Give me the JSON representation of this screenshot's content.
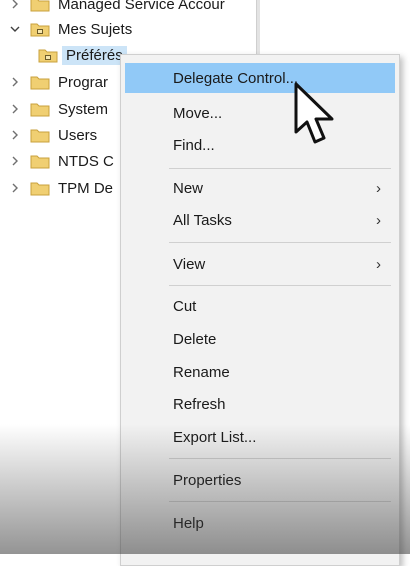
{
  "tree": {
    "items": [
      {
        "label": "Managed Service Accour",
        "expander": "collapsed"
      },
      {
        "label": "Mes Sujets",
        "expander": "expanded"
      },
      {
        "label": "Préférés",
        "expander": "none"
      },
      {
        "label": "Prograr",
        "expander": "collapsed"
      },
      {
        "label": "System",
        "expander": "collapsed"
      },
      {
        "label": "Users",
        "expander": "collapsed"
      },
      {
        "label": "NTDS C",
        "expander": "collapsed"
      },
      {
        "label": "TPM De",
        "expander": "collapsed"
      }
    ],
    "selected_index": 2,
    "folder_color": "#e8c46a",
    "selection_color": "#cce4f7"
  },
  "context_menu": {
    "items": [
      {
        "label": "Delegate Control...",
        "submenu": false,
        "highlighted": true
      },
      {
        "label": "Move...",
        "submenu": false
      },
      {
        "label": "Find...",
        "submenu": false
      },
      {
        "label": "New",
        "submenu": true
      },
      {
        "label": "All Tasks",
        "submenu": true
      },
      {
        "label": "View",
        "submenu": true
      },
      {
        "label": "Cut",
        "submenu": false
      },
      {
        "label": "Delete",
        "submenu": false
      },
      {
        "label": "Rename",
        "submenu": false
      },
      {
        "label": "Refresh",
        "submenu": false
      },
      {
        "label": "Export List...",
        "submenu": false
      },
      {
        "label": "Properties",
        "submenu": false
      },
      {
        "label": "Help",
        "submenu": false
      }
    ],
    "highlight_color": "#91c9f7",
    "submenu_arrow": "›"
  }
}
